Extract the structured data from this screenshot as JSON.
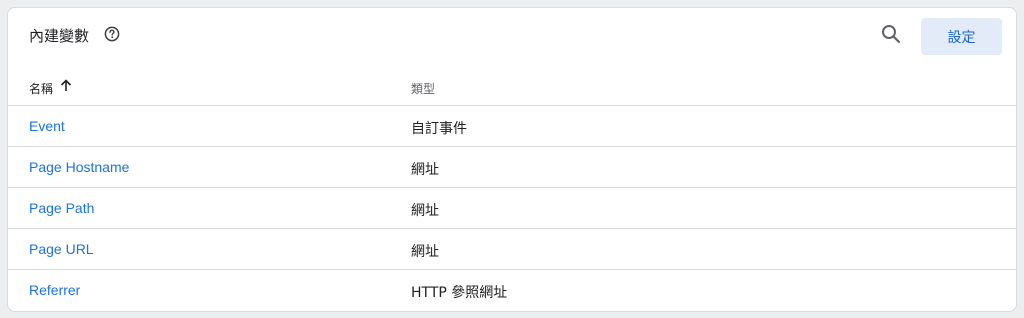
{
  "header": {
    "title": "內建變數",
    "config_label": "設定"
  },
  "table": {
    "columns": {
      "name": "名稱",
      "type": "類型"
    },
    "rows": [
      {
        "name": "Event",
        "type": "自訂事件"
      },
      {
        "name": "Page Hostname",
        "type": "網址"
      },
      {
        "name": "Page Path",
        "type": "網址"
      },
      {
        "name": "Page URL",
        "type": "網址"
      },
      {
        "name": "Referrer",
        "type": "HTTP 參照網址"
      }
    ]
  },
  "icons": {
    "help": "help-circle-icon",
    "search": "search-icon",
    "sort": "arrow-up-icon"
  },
  "colors": {
    "link": "#1a73e8",
    "button_bg": "#e3ebf9",
    "button_text": "#1967d2"
  }
}
